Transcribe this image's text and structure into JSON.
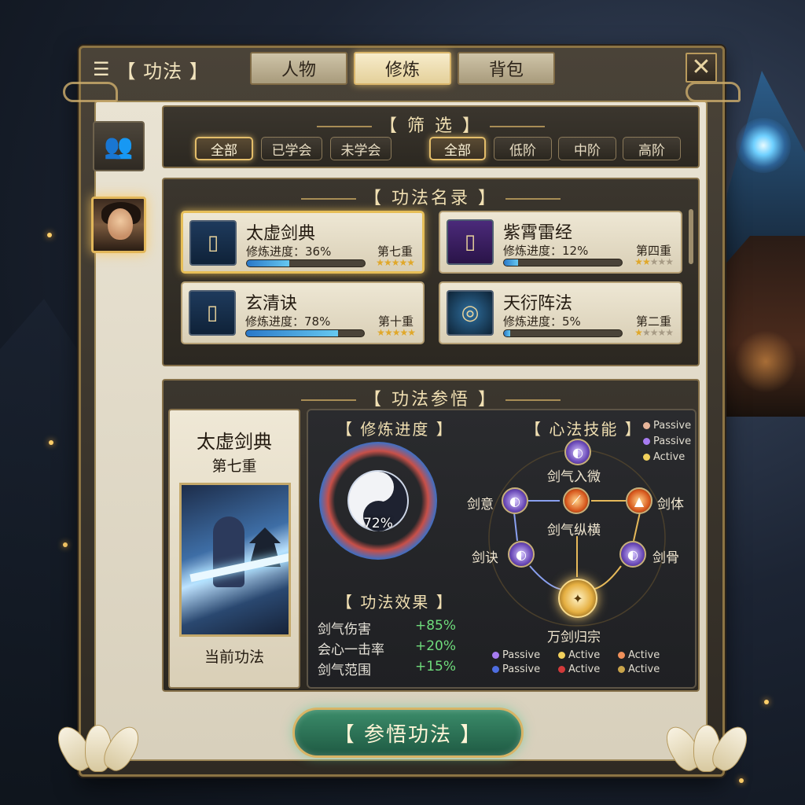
{
  "topbar": {
    "menu_title": "【 功法 】",
    "tabs": [
      {
        "label": "人物",
        "active": false
      },
      {
        "label": "修炼",
        "active": true
      },
      {
        "label": "背包",
        "active": false
      }
    ]
  },
  "filter": {
    "title": "【 筛 选 】",
    "learn_filters": [
      {
        "label": "全部",
        "active": true
      },
      {
        "label": "已学会",
        "active": false
      },
      {
        "label": "未学会",
        "active": false
      }
    ],
    "tier_filters": [
      {
        "label": "全部",
        "active": true
      },
      {
        "label": "低阶",
        "active": false
      },
      {
        "label": "中阶",
        "active": false
      },
      {
        "label": "高阶",
        "active": false
      }
    ]
  },
  "catalog": {
    "title": "【 功法名录 】",
    "items": [
      {
        "name": "太虚剑典",
        "progress_label": "修炼进度：36%",
        "progress": 0.36,
        "level": "第七重",
        "stars": 5,
        "icon": "sword-book-icon",
        "selected": true
      },
      {
        "name": "紫霄雷经",
        "progress_label": "修炼进度：12%",
        "progress": 0.12,
        "level": "第四重",
        "stars": 2,
        "icon": "thunder-book-icon",
        "selected": false
      },
      {
        "name": "玄清诀",
        "progress_label": "修炼进度：78%",
        "progress": 0.78,
        "level": "第十重",
        "stars": 5,
        "icon": "scroll-book-icon",
        "selected": false
      },
      {
        "name": "天衍阵法",
        "progress_label": "修炼进度：5%",
        "progress": 0.05,
        "level": "第二重",
        "stars": 1,
        "icon": "formation-icon",
        "selected": false
      }
    ]
  },
  "insight": {
    "title": "【 功法参悟 】",
    "name": "太虚剑典",
    "level": "第七重",
    "current_label": "当前功法",
    "progress_title": "【 修炼进度 】",
    "progress_value": "72%",
    "progress": 0.72,
    "effects_title": "【 功法效果 】",
    "effects": [
      {
        "label": "剑气伤害",
        "value": "+85%"
      },
      {
        "label": "会心一击率",
        "value": "+20%"
      },
      {
        "label": "剑气范围",
        "value": "+15%"
      }
    ],
    "skills_title": "【 心法技能 】",
    "nodes": {
      "top": "剑气入微",
      "center": "剑气纵横",
      "left": "剑意",
      "right": "剑体",
      "lower_left": "剑诀",
      "lower_right": "剑骨",
      "ultimate": "万剑归宗"
    },
    "legend_top": [
      "Passive",
      "Passive",
      "Active"
    ],
    "legend_bottom": [
      {
        "label": "Passive",
        "color": "#a77cf0"
      },
      {
        "label": "Active",
        "color": "#f2d15c"
      },
      {
        "label": "Active",
        "color": "#f0905a"
      },
      {
        "label": "Passive",
        "color": "#4e6de0"
      },
      {
        "label": "Active",
        "color": "#d23a3a"
      },
      {
        "label": "Active",
        "color": "#c9a44a"
      }
    ]
  },
  "action": {
    "label": "【 参悟功法 】"
  }
}
